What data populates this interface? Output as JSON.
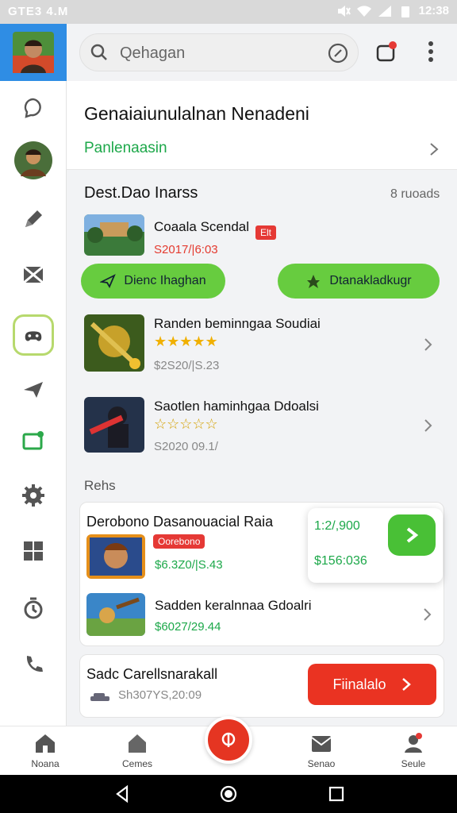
{
  "status_bar": {
    "left_text": "GTE3 4.M",
    "time": "12:38"
  },
  "search": {
    "text": "Qehagan"
  },
  "header": {
    "title": "Genaiaiunulalnan Nenadeni",
    "subtitle": "Panlenaasin"
  },
  "section1": {
    "title": "Dest.Dao Inarss",
    "meta": "8 ruoads",
    "featured": {
      "title": "Coaala Scendal",
      "badge": "Elt",
      "price": "S2017/|6:03"
    },
    "buttons": {
      "left": "Dienc Ihaghan",
      "right": "Dtanakladkugr"
    },
    "items": [
      {
        "title": "Randen beminngaa Soudiai",
        "rating": "★★★★★",
        "price": "$2S20/|S.23"
      },
      {
        "title": "Saotlen haminhgaa Ddoalsi",
        "rating": "☆☆☆☆☆",
        "price": "S2020 09.1/"
      }
    ]
  },
  "section2": {
    "title": "Rehs",
    "card": {
      "title": "Derobono Dasanouacial Raia",
      "badge": "Oorebono",
      "price": "$6.3Z0/|S.43",
      "popout": {
        "count": "1:2/,900",
        "price": "$156:036"
      },
      "item2": {
        "title": "Sadden keralnnaa Gdoalri",
        "price": "$6027/29.44"
      }
    }
  },
  "promo": {
    "title": "Sadc Carellsnarakall",
    "price": "Sh307YS,20:09",
    "button": "Fiinalalo"
  },
  "bottom_nav": {
    "items": [
      "Noana",
      "Cemes",
      "Senao",
      "Seule"
    ]
  },
  "colors": {
    "accent_green": "#67cc3f",
    "accent_red": "#e53522",
    "sidebar_top": "#2f8de4"
  }
}
